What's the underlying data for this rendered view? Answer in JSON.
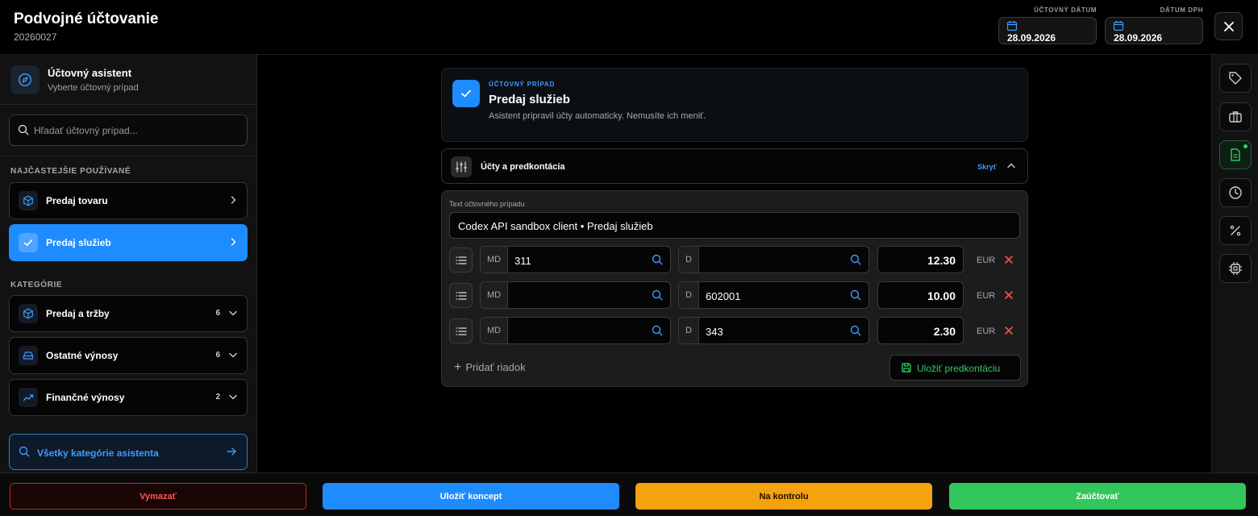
{
  "header": {
    "title": "Podvojné účtovanie",
    "doc_number": "20260027",
    "accounting_date_label": "ÚČTOVNÝ DÁTUM",
    "accounting_date": "28.09.2026",
    "vat_date_label": "DÁTUM DPH",
    "vat_date": "28.09.2026"
  },
  "sidebar": {
    "assistant_title": "Účtovný asistent",
    "assistant_subtitle": "Vyberte účtovný prípad",
    "search_placeholder": "Hľadať účtovný prípad...",
    "frequent_label": "NAJČASTEJŠIE POUŽÍVANÉ",
    "frequent": [
      {
        "label": "Predaj tovaru",
        "icon": "box-icon",
        "active": false
      },
      {
        "label": "Predaj služieb",
        "icon": "check-icon",
        "active": true
      }
    ],
    "categories_label": "KATEGÓRIE",
    "categories": [
      {
        "label": "Predaj a tržby",
        "count": "6",
        "icon": "box-icon"
      },
      {
        "label": "Ostatné výnosy",
        "count": "6",
        "icon": "tray-icon"
      },
      {
        "label": "Finančné výnosy",
        "count": "2",
        "icon": "trend-up-icon"
      }
    ],
    "all_categories": "Všetky kategórie asistenta"
  },
  "case": {
    "tag": "ÚČTOVNÝ PRÍPAD",
    "title": "Predaj služieb",
    "description": "Asistent pripravil účty automaticky. Nemusíte ich meniť."
  },
  "accounts": {
    "title": "Účty a predkontácia",
    "hide_label": "Skryť",
    "text_label": "Text účtovného prípadu",
    "text_value": "Codex API sandbox client • Predaj služieb",
    "md_label": "MD",
    "d_label": "D",
    "currency": "EUR",
    "rows": [
      {
        "md": "311",
        "d": "",
        "amount": "12.30"
      },
      {
        "md": "",
        "d": "602001",
        "amount": "10.00"
      },
      {
        "md": "",
        "d": "343",
        "amount": "2.30"
      }
    ],
    "add_row": "Pridať riadok",
    "save_template": "Uložiť predkontáciu"
  },
  "rail": [
    "tag-icon",
    "briefcase-icon",
    "document-icon",
    "clock-icon",
    "percent-icon",
    "chip-icon"
  ],
  "footer": {
    "delete": "Vymazať",
    "save_draft": "Uložiť koncept",
    "to_review": "Na kontrolu",
    "post": "Zaúčtovať"
  },
  "colors": {
    "accent": "#1e8bff",
    "success": "#32c75c",
    "warning": "#f4a20e",
    "danger": "#ff5656"
  }
}
